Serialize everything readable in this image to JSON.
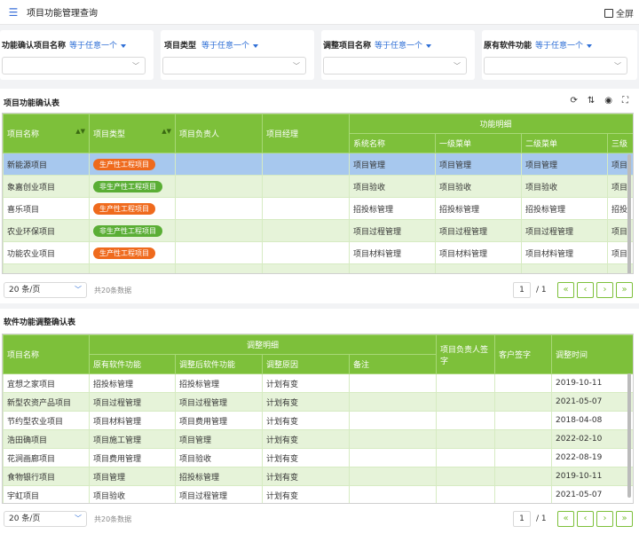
{
  "header": {
    "title": "项目功能管理查询",
    "fullscreen": "全屏"
  },
  "filters": [
    {
      "label": "功能确认项目名称",
      "op": "等于任意一个"
    },
    {
      "label": "项目类型",
      "op": "等于任意一个"
    },
    {
      "label": "调整项目名称",
      "op": "等于任意一个"
    },
    {
      "label": "原有软件功能",
      "op": "等于任意一个"
    }
  ],
  "table1": {
    "title": "项目功能确认表",
    "headers": {
      "name": "项目名称",
      "type": "项目类型",
      "owner": "项目负责人",
      "manager": "项目经理",
      "detail": "功能明细",
      "sys": "系统名称",
      "m1": "一级菜单",
      "m2": "二级菜单",
      "m3": "三级"
    },
    "rows": [
      {
        "name": "新能源项目",
        "type": "生产性工程项目",
        "tag": "red",
        "sys": "项目管理",
        "m1": "项目管理",
        "m2": "项目管理",
        "m3": "项目"
      },
      {
        "name": "象嘉创业项目",
        "type": "非生产性工程项目",
        "tag": "green",
        "sys": "项目验收",
        "m1": "项目验收",
        "m2": "项目验收",
        "m3": "项目"
      },
      {
        "name": "喜乐项目",
        "type": "生产性工程项目",
        "tag": "red",
        "sys": "招投标管理",
        "m1": "招投标管理",
        "m2": "招投标管理",
        "m3": "招投"
      },
      {
        "name": "农业环保项目",
        "type": "非生产性工程项目",
        "tag": "green",
        "sys": "项目过程管理",
        "m1": "项目过程管理",
        "m2": "项目过程管理",
        "m3": "项目"
      },
      {
        "name": "功能农业项目",
        "type": "生产性工程项目",
        "tag": "red",
        "sys": "项目材料管理",
        "m1": "项目材料管理",
        "m2": "项目材料管理",
        "m3": "项目"
      }
    ],
    "pager": {
      "size": "20 条/页",
      "total": "共20条数据",
      "page": "1",
      "pages": "/ 1"
    }
  },
  "table2": {
    "title": "软件功能调整确认表",
    "headers": {
      "name": "项目名称",
      "detail": "调整明细",
      "orig": "原有软件功能",
      "adj": "调整后软件功能",
      "reason": "调整原因",
      "note": "备注",
      "sign1": "项目负责人签字",
      "sign2": "客户签字",
      "time": "调整时间"
    },
    "rows": [
      {
        "name": "宜想之家项目",
        "orig": "招投标管理",
        "adj": "招投标管理",
        "reason": "计划有变",
        "time": "2019-10-11"
      },
      {
        "name": "新型农资产品项目",
        "orig": "项目过程管理",
        "adj": "项目过程管理",
        "reason": "计划有变",
        "time": "2021-05-07"
      },
      {
        "name": "节约型农业项目",
        "orig": "项目材料管理",
        "adj": "项目费用管理",
        "reason": "计划有变",
        "time": "2018-04-08"
      },
      {
        "name": "浩田确项目",
        "orig": "项目施工管理",
        "adj": "项目管理",
        "reason": "计划有变",
        "time": "2022-02-10"
      },
      {
        "name": "花涧画廊项目",
        "orig": "项目费用管理",
        "adj": "项目验收",
        "reason": "计划有变",
        "time": "2022-08-19"
      },
      {
        "name": "食物银行项目",
        "orig": "项目管理",
        "adj": "招投标管理",
        "reason": "计划有变",
        "time": "2019-10-11"
      },
      {
        "name": "宇虹项目",
        "orig": "项目验收",
        "adj": "项目过程管理",
        "reason": "计划有变",
        "time": "2021-05-07"
      }
    ],
    "pager": {
      "size": "20 条/页",
      "total": "共20条数据",
      "page": "1",
      "pages": "/ 1"
    }
  }
}
